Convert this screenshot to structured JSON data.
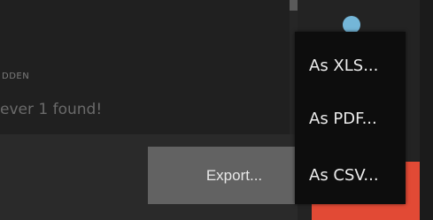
{
  "results": {
    "hidden_label": "DDEN",
    "found_text": "ever 1 found!"
  },
  "export": {
    "label": "Export..."
  },
  "export_menu": {
    "items": [
      {
        "label": "As XLS..."
      },
      {
        "label": "As PDF..."
      },
      {
        "label": "As CSV..."
      }
    ]
  },
  "colors": {
    "accent_red": "#e24a35",
    "status_dot": "#74b6d8",
    "export_button_bg": "#626262",
    "menu_bg": "#0d0d0d"
  },
  "icons": {
    "status": "status-dot-icon"
  }
}
